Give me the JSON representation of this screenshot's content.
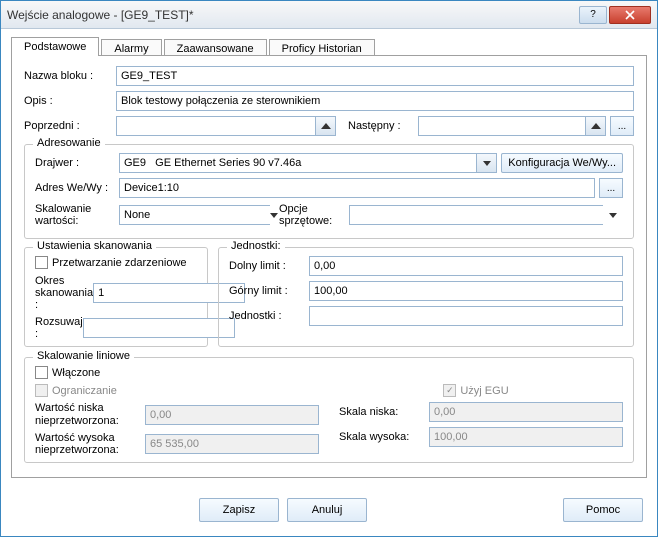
{
  "window": {
    "title": "Wejście analogowe - [GE9_TEST]*"
  },
  "tabs": {
    "basic": "Podstawowe",
    "alarms": "Alarmy",
    "advanced": "Zaawansowane",
    "historian": "Proficy Historian"
  },
  "fields": {
    "nazwa_label": "Nazwa bloku :",
    "nazwa_value": "GE9_TEST",
    "opis_label": "Opis :",
    "opis_value": "Blok testowy połączenia ze sterownikiem",
    "poprzedni_label": "Poprzedni :",
    "poprzedni_value": "",
    "nastepny_label": "Następny :",
    "nastepny_value": ""
  },
  "addressing": {
    "group_title": "Adresowanie",
    "drajwer_label": "Drajwer :",
    "drajwer_value": "GE9   GE Ethernet Series 90 v7.46a",
    "konf_btn": "Konfiguracja We/Wy...",
    "adres_label": "Adres We/Wy :",
    "adres_value": "Device1:10",
    "skal_label": "Skalowanie wartości:",
    "skal_value": "None",
    "opcje_label": "Opcje sprzętowe:",
    "opcje_value": ""
  },
  "scan": {
    "group_title": "Ustawienia skanowania",
    "przetw_label": "Przetwarzanie zdarzeniowe",
    "okres_label": "Okres skanowania :",
    "okres_value": "1",
    "rozs_label": "Rozsuwaj :",
    "rozs_value": ""
  },
  "units": {
    "group_title": "Jednostki:",
    "dolny_label": "Dolny limit :",
    "dolny_value": "0,00",
    "gorny_label": "Górny limit :",
    "gorny_value": "100,00",
    "jedn_label": "Jednostki :",
    "jedn_value": ""
  },
  "linear": {
    "group_title": "Skalowanie liniowe",
    "wlaczone_label": "Włączone",
    "ogr_label": "Ograniczanie",
    "egu_label": "Użyj EGU",
    "wnisk_label": "Wartość niska nieprzetworzona:",
    "wnisk_value": "0,00",
    "wwys_label": "Wartość wysoka nieprzetworzona:",
    "wwys_value": "65 535,00",
    "snisk_label": "Skala niska:",
    "snisk_value": "0,00",
    "swys_label": "Skala wysoka:",
    "swys_value": "100,00"
  },
  "footer": {
    "save": "Zapisz",
    "cancel": "Anuluj",
    "help": "Pomoc"
  }
}
